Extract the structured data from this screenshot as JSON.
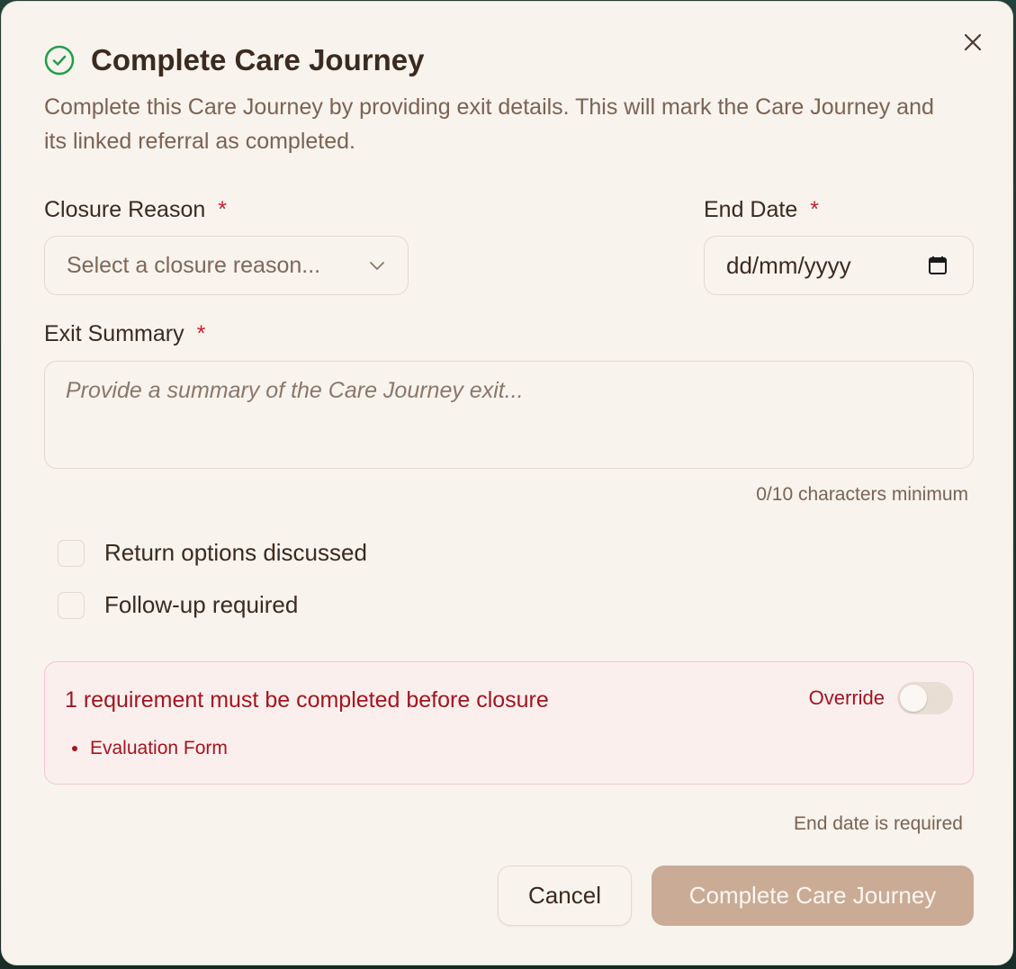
{
  "dialog": {
    "title": "Complete Care Journey",
    "description": "Complete this Care Journey by providing exit details. This will mark the Care Journey and its linked referral as completed.",
    "close_icon": "close-icon",
    "title_icon": "check-circle-icon"
  },
  "fields": {
    "closure_reason": {
      "label": "Closure Reason",
      "required_marker": "*",
      "placeholder": "Select a closure reason...",
      "value": ""
    },
    "end_date": {
      "label": "End Date",
      "required_marker": "*",
      "placeholder": "dd/mm/yyyy",
      "value": ""
    },
    "exit_summary": {
      "label": "Exit Summary",
      "required_marker": "*",
      "placeholder": "Provide a summary of the Care Journey exit...",
      "value": "",
      "char_count": "0/10 characters minimum"
    }
  },
  "checkboxes": [
    {
      "label": "Return options discussed",
      "checked": false
    },
    {
      "label": "Follow-up required",
      "checked": false
    }
  ],
  "requirements_alert": {
    "title": "1 requirement must be completed before closure",
    "override_label": "Override",
    "override_on": false,
    "items": [
      "Evaluation Form"
    ]
  },
  "validation_message": "End date is required",
  "buttons": {
    "cancel": "Cancel",
    "submit": "Complete Care Journey"
  },
  "colors": {
    "dialog_bg": "#f8f3ed",
    "text_primary": "#3b2a1f",
    "text_muted": "#7a6354",
    "required": "#cc1f2b",
    "alert_text": "#a3151f",
    "alert_bg": "#fbefee",
    "success_icon": "#1e9e4a",
    "primary_disabled": "#c9ab96"
  }
}
